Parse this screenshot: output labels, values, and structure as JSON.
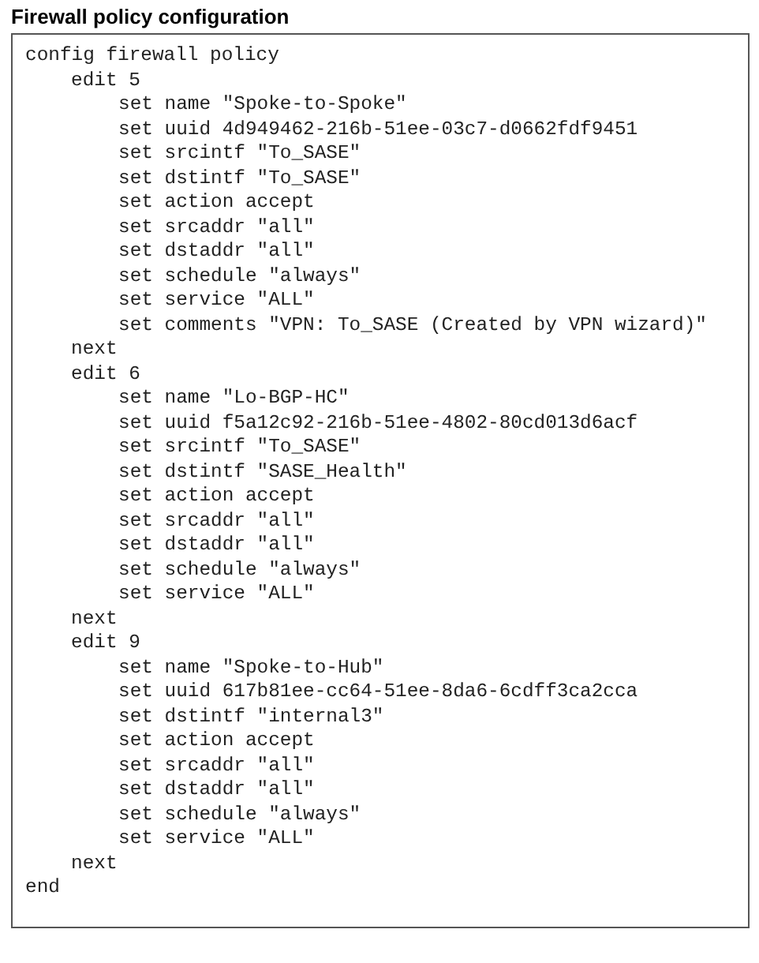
{
  "title": "Firewall policy configuration",
  "config": {
    "header": "config firewall policy",
    "entries": [
      {
        "edit": "edit 5",
        "settings": [
          "set name \"Spoke-to-Spoke\"",
          "set uuid 4d949462-216b-51ee-03c7-d0662fdf9451",
          "set srcintf \"To_SASE\"",
          "set dstintf \"To_SASE\"",
          "set action accept",
          "set srcaddr \"all\"",
          "set dstaddr \"all\"",
          "set schedule \"always\"",
          "set service \"ALL\"",
          "set comments \"VPN: To_SASE (Created by VPN wizard)\""
        ],
        "close": "next"
      },
      {
        "edit": "edit 6",
        "settings": [
          "set name \"Lo-BGP-HC\"",
          "set uuid f5a12c92-216b-51ee-4802-80cd013d6acf",
          "set srcintf \"To_SASE\"",
          "set dstintf \"SASE_Health\"",
          "set action accept",
          "set srcaddr \"all\"",
          "set dstaddr \"all\"",
          "set schedule \"always\"",
          "set service \"ALL\""
        ],
        "close": "next"
      },
      {
        "edit": "edit 9",
        "settings": [
          "set name \"Spoke-to-Hub\"",
          "set uuid 617b81ee-cc64-51ee-8da6-6cdff3ca2cca",
          "set dstintf \"internal3\"",
          "set action accept",
          "set srcaddr \"all\"",
          "set dstaddr \"all\"",
          "set schedule \"always\"",
          "set service \"ALL\""
        ],
        "close": "next"
      }
    ],
    "footer": "end"
  }
}
